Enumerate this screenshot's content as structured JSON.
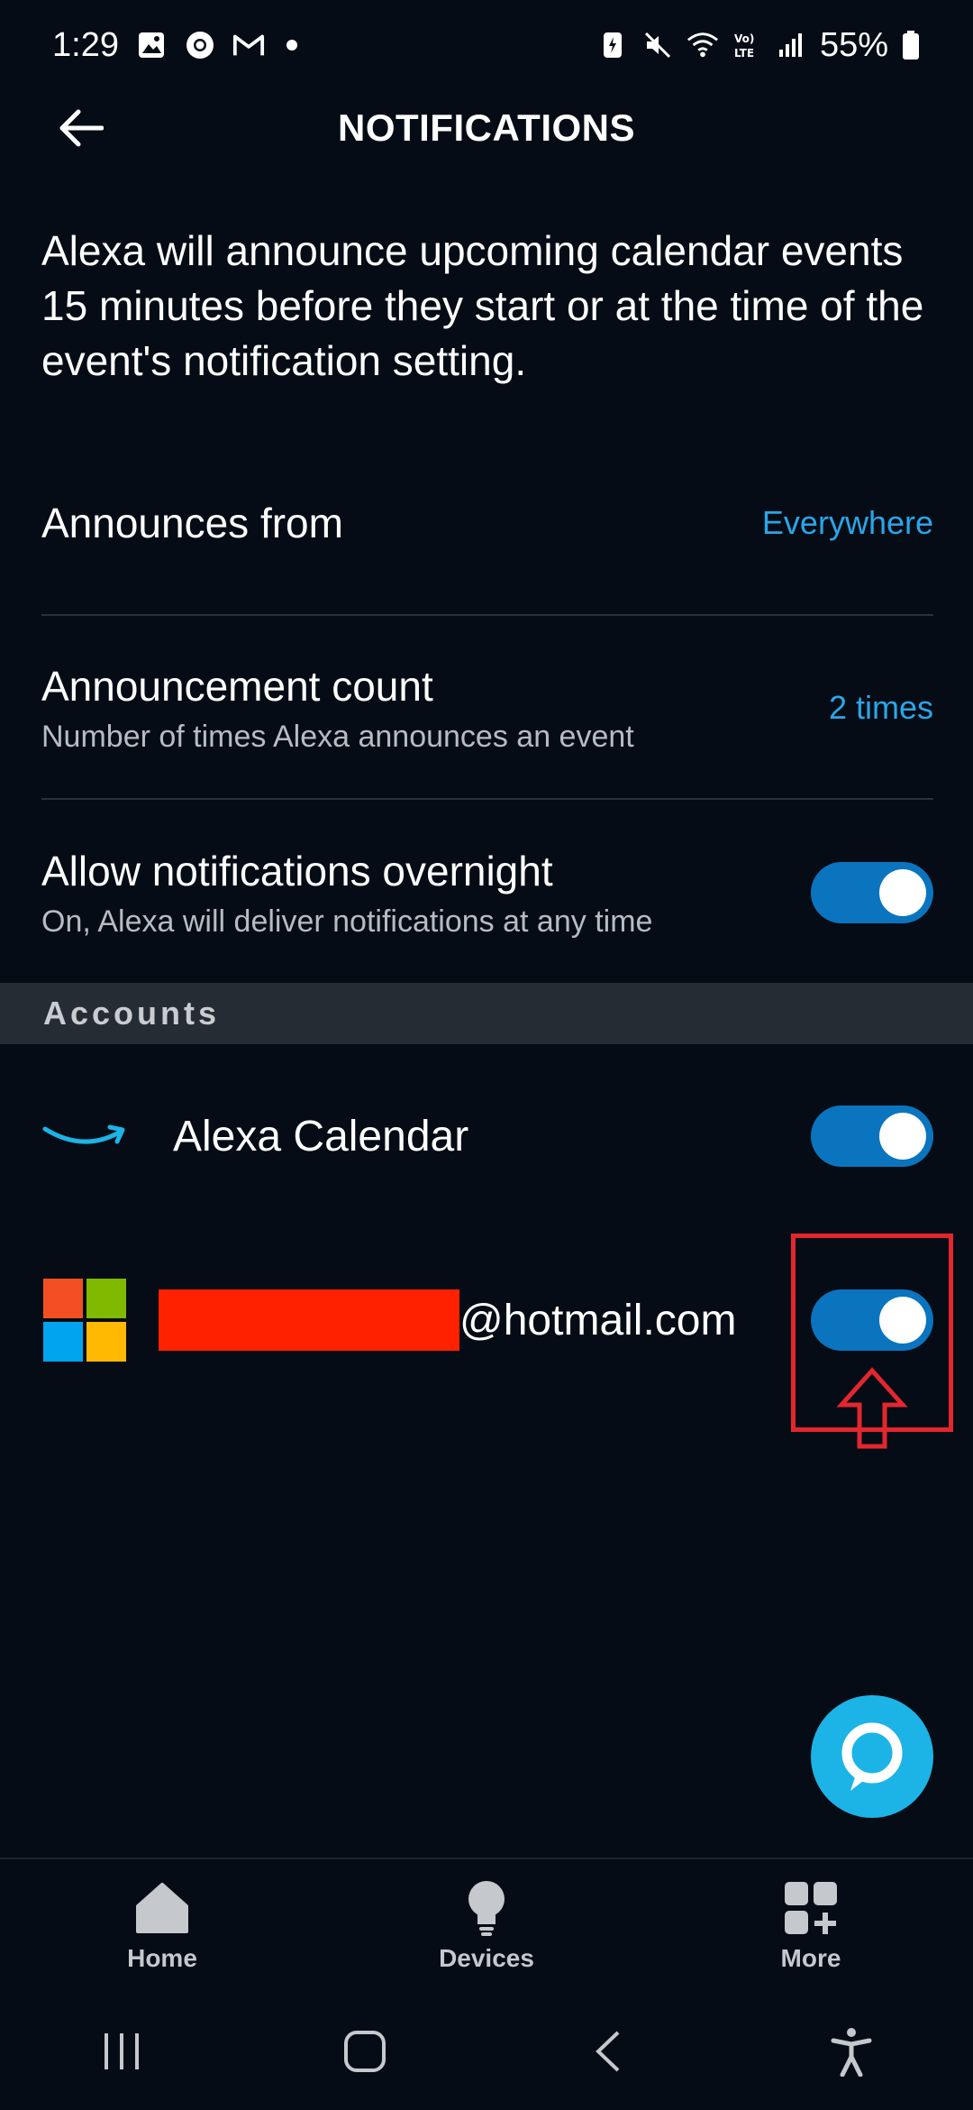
{
  "status": {
    "time": "1:29",
    "battery": "55%",
    "network": "VoLTE"
  },
  "header": {
    "title": "NOTIFICATIONS"
  },
  "intro_text": "Alexa will announce upcoming calendar events 15 minutes before they start or at the time of the event's notification setting.",
  "settings": [
    {
      "title": "Announces from",
      "value": "Everywhere"
    },
    {
      "title": "Announcement count",
      "subtitle": "Number of times Alexa announces an event",
      "value": "2 times"
    },
    {
      "title": "Allow notifications overnight",
      "subtitle": "On, Alexa will deliver notifications at any time",
      "toggle_on": true
    }
  ],
  "accounts": {
    "header": "Accounts",
    "items": [
      {
        "label": "Alexa Calendar",
        "icon": "amazon-smile-icon",
        "toggle_on": true
      },
      {
        "label": "@hotmail.com",
        "icon": "microsoft-logo-icon",
        "toggle_on": true,
        "redacted": true
      }
    ]
  },
  "bottom_nav": {
    "items": [
      {
        "label": "Home",
        "icon": "home-icon"
      },
      {
        "label": "Devices",
        "icon": "bulb-icon"
      },
      {
        "label": "More",
        "icon": "grid-plus-icon"
      }
    ]
  },
  "colors": {
    "background": "#050c15",
    "accent": "#2aa6e8",
    "toggle": "#0a74bf",
    "fab": "#1cb4e6",
    "highlight": "#e3262f",
    "redaction": "#ff2100"
  }
}
